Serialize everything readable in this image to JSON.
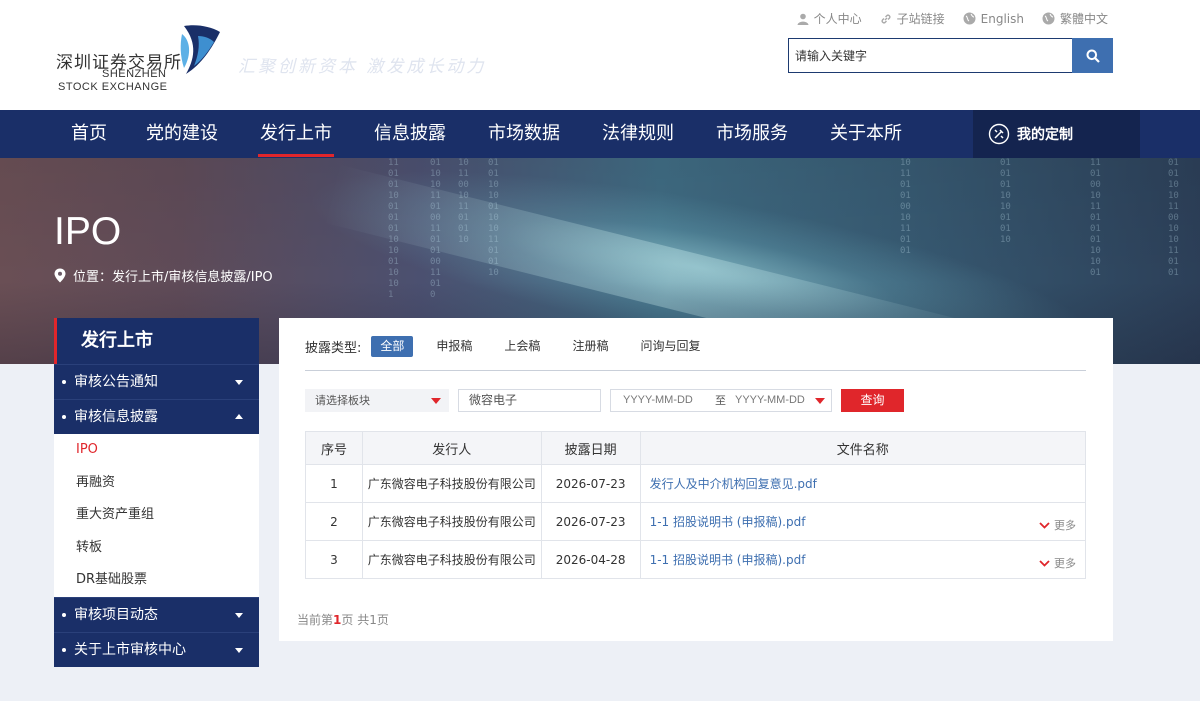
{
  "header": {
    "logo_cn": "深圳证券交易所",
    "logo_en_line1": "SHENZHEN",
    "logo_en_line2": "STOCK EXCHANGE",
    "slogan": "汇聚创新资本  激发成长动力",
    "util_links": [
      {
        "label": "个人中心",
        "icon": "user-icon"
      },
      {
        "label": "子站链接",
        "icon": "link-icon"
      },
      {
        "label": "English",
        "icon": "globe-icon"
      },
      {
        "label": "繁體中文",
        "icon": "globe-icon"
      }
    ],
    "search": {
      "placeholder": "请输入关键字",
      "icon": "search-icon"
    }
  },
  "nav": {
    "items": [
      "首页",
      "党的建设",
      "发行上市",
      "信息披露",
      "市场数据",
      "法律规则",
      "市场服务",
      "关于本所"
    ],
    "active": "发行上市",
    "custom_label": "我的定制"
  },
  "banner": {
    "title": "IPO",
    "breadcrumb": "位置：发行上市/审核信息披露/IPO"
  },
  "sidebar": {
    "title": "发行上市",
    "categories_top": [
      {
        "label": "审核公告通知",
        "expanded": false
      },
      {
        "label": "审核信息披露",
        "expanded": true
      }
    ],
    "sub_items": [
      "IPO",
      "再融资",
      "重大资产重组",
      "转板",
      "DR基础股票"
    ],
    "active_sub": "IPO",
    "categories_bottom": [
      {
        "label": "审核项目动态",
        "expanded": false
      },
      {
        "label": "关于上市审核中心",
        "expanded": false
      }
    ]
  },
  "filters": {
    "type_label": "披露类型:",
    "types": [
      "全部",
      "申报稿",
      "上会稿",
      "注册稿",
      "问询与回复"
    ],
    "active_type": "全部",
    "board_select": "请选择板块",
    "keyword": "微容电子",
    "date_start_placeholder": "YYYY-MM-DD",
    "date_sep": "至",
    "date_end_placeholder": "YYYY-MM-DD",
    "query_label": "查询"
  },
  "table": {
    "headers": [
      "序号",
      "发行人",
      "披露日期",
      "文件名称"
    ],
    "rows": [
      {
        "no": "1",
        "issuer": "广东微容电子科技股份有限公司",
        "date": "2026-07-23",
        "file": "发行人及中介机构回复意见.pdf",
        "more": ""
      },
      {
        "no": "2",
        "issuer": "广东微容电子科技股份有限公司",
        "date": "2026-07-23",
        "file": "1-1 招股说明书 (申报稿).pdf",
        "more": "更多"
      },
      {
        "no": "3",
        "issuer": "广东微容电子科技股份有限公司",
        "date": "2026-04-28",
        "file": "1-1 招股说明书 (申报稿).pdf",
        "more": "更多"
      }
    ]
  },
  "pager": {
    "prefix": "当前第",
    "current": "1",
    "suffix": "页 共1页"
  },
  "colors": {
    "navy": "#1a2f68",
    "accent_red": "#e0262b",
    "accent_blue": "#3e6fb0"
  }
}
